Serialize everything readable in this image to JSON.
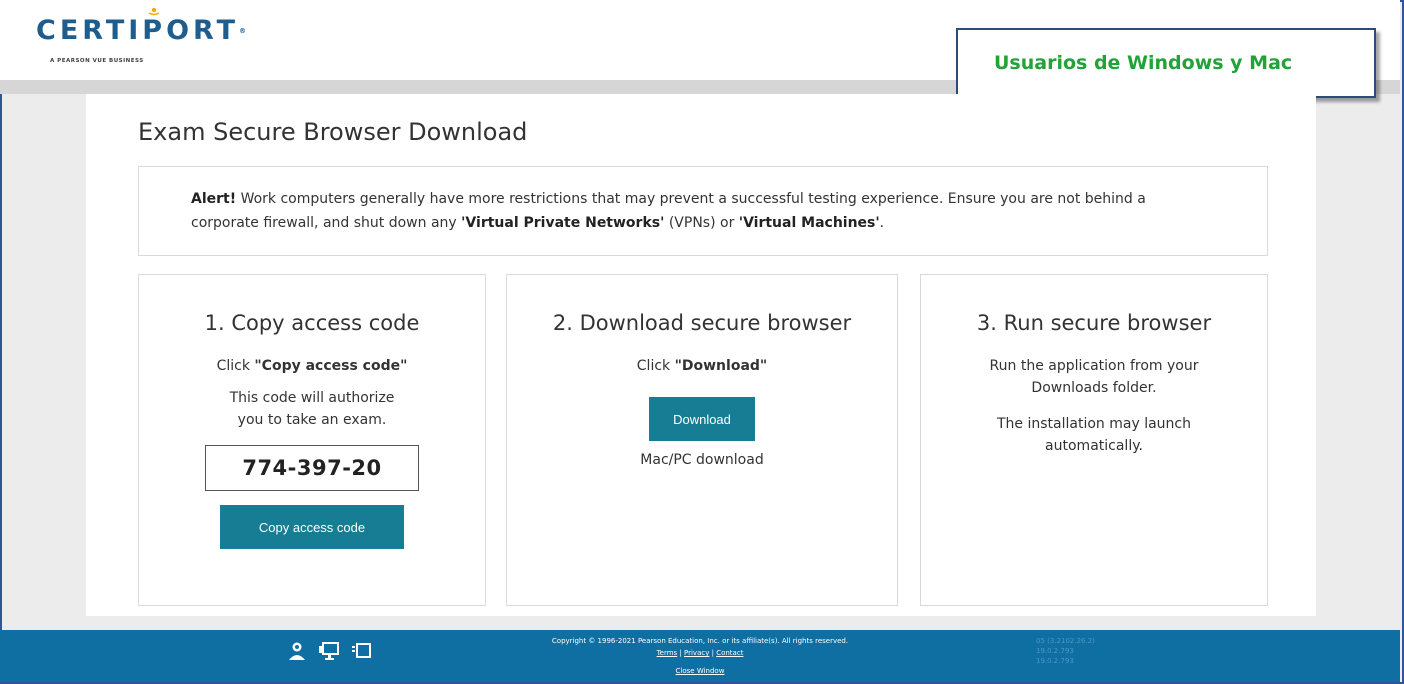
{
  "header": {
    "logo_text": "CERTIPORT",
    "logo_subtext": "A PEARSON VUE BUSINESS",
    "callout_text": "Usuarios de Windows y Mac"
  },
  "page": {
    "title": "Exam Secure Browser Download"
  },
  "alert": {
    "label": "Alert!",
    "text_1": " Work computers generally have more restrictions that may prevent a successful testing experience. Ensure you are not behind a corporate firewall, and shut down any ",
    "vpn_label": "'Virtual Private Networks'",
    "text_2": " (VPNs) or ",
    "vm_label": "'Virtual Machines'",
    "text_3": "."
  },
  "steps": {
    "copy": {
      "number": "1",
      "title": ". Copy access code",
      "click_prefix": "Click ",
      "click_target": "\"Copy access code\"",
      "description": "This code will authorize you to take an exam.",
      "access_code": "774-397-20",
      "button_label": "Copy access code"
    },
    "download": {
      "number": "2",
      "title": ". Download secure browser",
      "click_prefix": "Click ",
      "click_target": "\"Download\"",
      "button_label": "Download",
      "subtext": "Mac/PC download"
    },
    "run": {
      "number": "3",
      "title": ". Run secure browser",
      "line_1": "Run the application from your Downloads folder.",
      "line_2": "The installation may launch automatically."
    }
  },
  "footer": {
    "copyright": "Copyright © 1996-2021 Pearson Education, Inc. or its affiliate(s). All rights reserved.",
    "links": [
      "Terms",
      "Privacy",
      "Contact"
    ],
    "link_separator": "|",
    "close_window": "Close Window",
    "version_lines": [
      "05 (3.2102.26.2)",
      "19.0.2.793",
      "19.0.2.793"
    ],
    "icons": [
      "user-support-icon",
      "monitor-icon",
      "display-icon"
    ]
  },
  "colors": {
    "brand_blue": "#1f5d8f",
    "button_teal": "#167d94",
    "footer_blue": "#0f6fa3",
    "callout_green": "#22a337",
    "frame_border": "#2e5597"
  }
}
